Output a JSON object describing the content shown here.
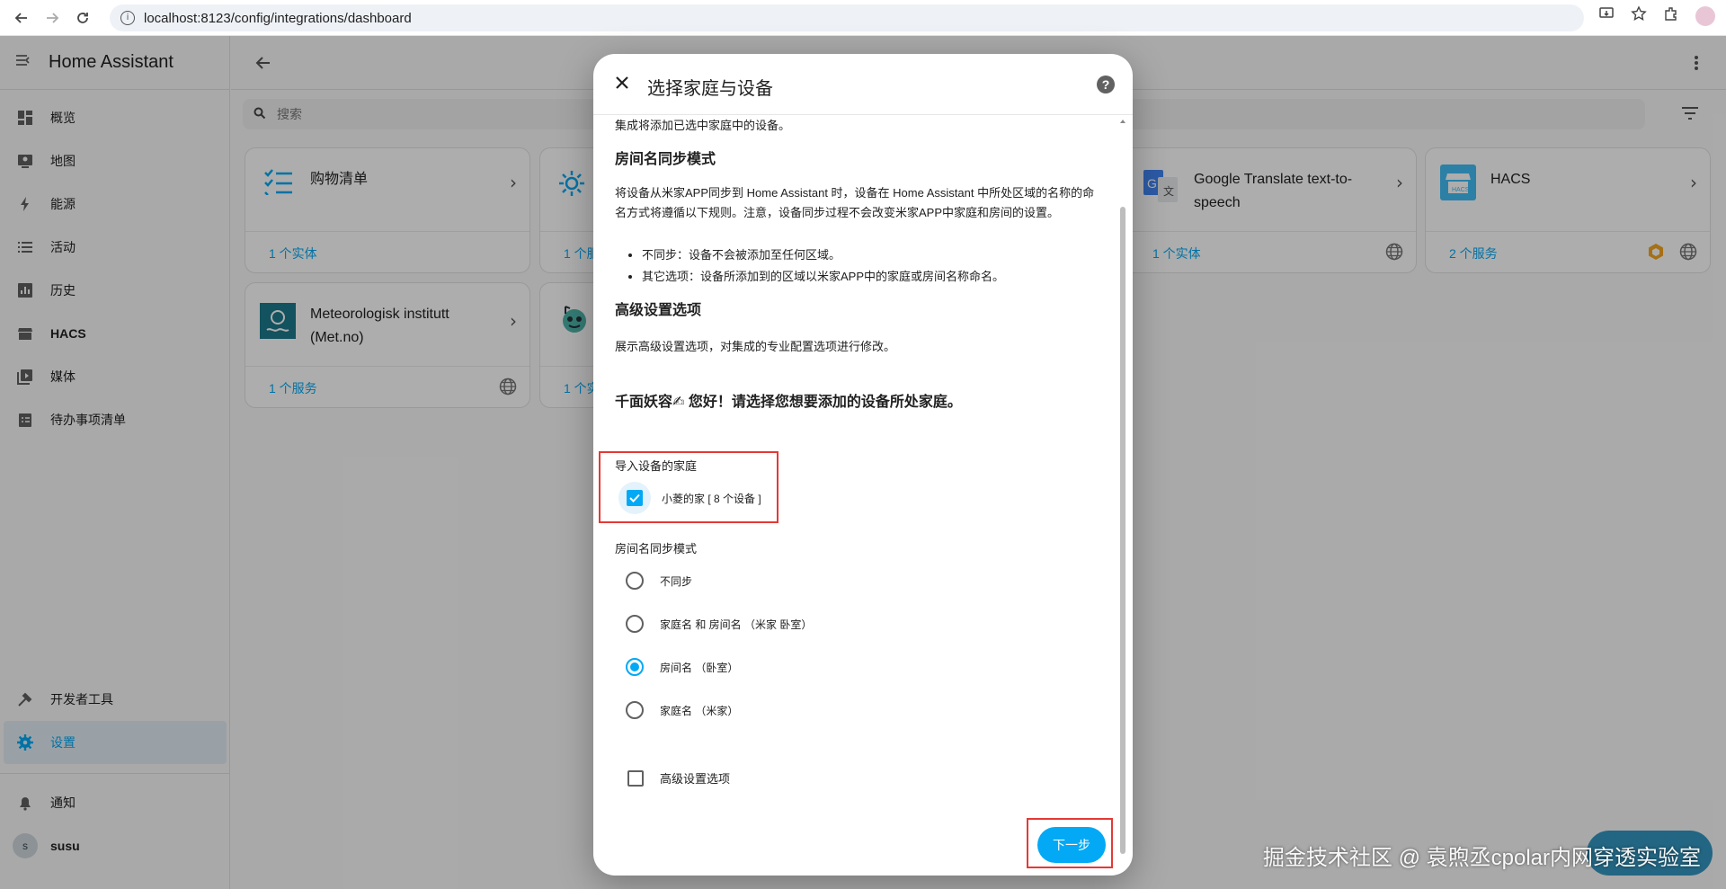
{
  "browser": {
    "url": "localhost:8123/config/integrations/dashboard"
  },
  "sidebar": {
    "title": "Home Assistant",
    "items": [
      {
        "label": "概览",
        "icon": "dashboard-icon"
      },
      {
        "label": "地图",
        "icon": "map-icon"
      },
      {
        "label": "能源",
        "icon": "lightning-icon"
      },
      {
        "label": "活动",
        "icon": "list-icon"
      },
      {
        "label": "历史",
        "icon": "chart-icon"
      },
      {
        "label": "HACS",
        "icon": "hacs-icon"
      },
      {
        "label": "媒体",
        "icon": "media-icon"
      },
      {
        "label": "待办事项清单",
        "icon": "clipboard-icon"
      }
    ],
    "dev_tools": "开发者工具",
    "settings": "设置",
    "notifications": "通知",
    "user_name": "susu",
    "user_initial": "s"
  },
  "main": {
    "search_placeholder": "搜索",
    "cards": [
      {
        "name": "购物清单",
        "link": "1 个实体"
      },
      {
        "name": "Google Translate text-to-speech",
        "link": "1 个实体"
      },
      {
        "name": "HACS",
        "link": "2 个服务"
      },
      {
        "name": "Meteorologisk institutt (Met.no)",
        "link": "1 个服务"
      }
    ],
    "partial_links": [
      "1 个服",
      "1 个实"
    ]
  },
  "dialog": {
    "title": "选择家庭与设备",
    "intro": "集成将添加已选中家庭中的设备。",
    "room_sync_heading": "房间名同步模式",
    "room_sync_desc": "将设备从米家APP同步到 Home Assistant 时，设备在 Home Assistant 中所处区域的名称的命名方式将遵循以下规则。注意，设备同步过程不会改变米家APP中家庭和房间的设置。",
    "bullets": [
      "不同步：设备不会被添加至任何区域。",
      "其它选项：设备所添加到的区域以米家APP中的家庭或房间名称命名。"
    ],
    "advanced_heading": "高级设置选项",
    "advanced_desc": "展示高级设置选项，对集成的专业配置选项进行修改。",
    "greeting": "千面妖容✍ 您好！请选择您想要添加的设备所处家庭。",
    "home_label": "导入设备的家庭",
    "home_option": "小菱的家 [ 8 个设备 ]",
    "room_mode_label": "房间名同步模式",
    "room_options": [
      {
        "label": "不同步",
        "selected": false
      },
      {
        "label": "家庭名 和 房间名 （米家 卧室）",
        "selected": false
      },
      {
        "label": "房间名 （卧室）",
        "selected": true
      },
      {
        "label": "家庭名 （米家）",
        "selected": false
      }
    ],
    "advanced_checkbox": "高级设置选项",
    "next_button": "下一步"
  },
  "watermark": "掘金技术社区 @ 袁煦丞cpolar内网穿透实验室",
  "colors": {
    "accent": "#03a9f4",
    "highlight_box": "#e53935"
  }
}
